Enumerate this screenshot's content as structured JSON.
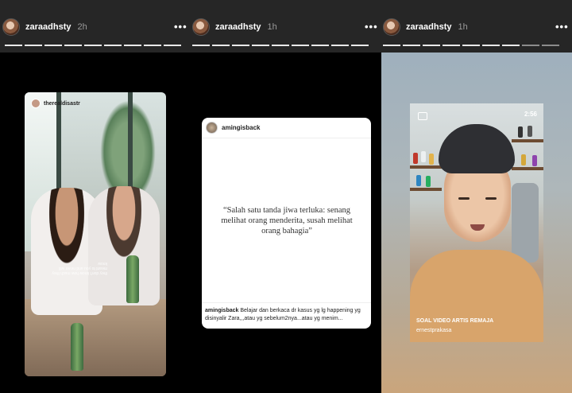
{
  "stories": [
    {
      "username": "zaraadhsty",
      "time": "2h",
      "more": "•••"
    },
    {
      "username": "zaraadhsty",
      "time": "1h",
      "more": "•••"
    },
    {
      "username": "zaraadhsty",
      "time": "1h",
      "more": "•••"
    }
  ],
  "photo_post": {
    "tag_username": "therealdisastr",
    "handwriting": "they don't know how much they meant to you and never will know"
  },
  "quote_post": {
    "username": "amingisback",
    "quote": "“Salah satu tanda jiwa terluka: senang melihat orang menderita, susah melihat orang bahagia”",
    "caption_user": "amingisback",
    "caption_text": "Belajar dan berkaca dr kasus yg lg happening yg disinyalir Zara,,,atau yg sebelum2nya...atau yg menim..."
  },
  "video_post": {
    "duration": "2:56",
    "title": "SOAL VIDEO ARTIS REMAJA",
    "author": "ernestprakasa"
  },
  "colors": {
    "topbar": "#262626",
    "progress_done": "#e9e9e9",
    "progress_pending": "#8c8c8c"
  },
  "icons": [
    "more-options-icon",
    "video-camera-icon"
  ]
}
